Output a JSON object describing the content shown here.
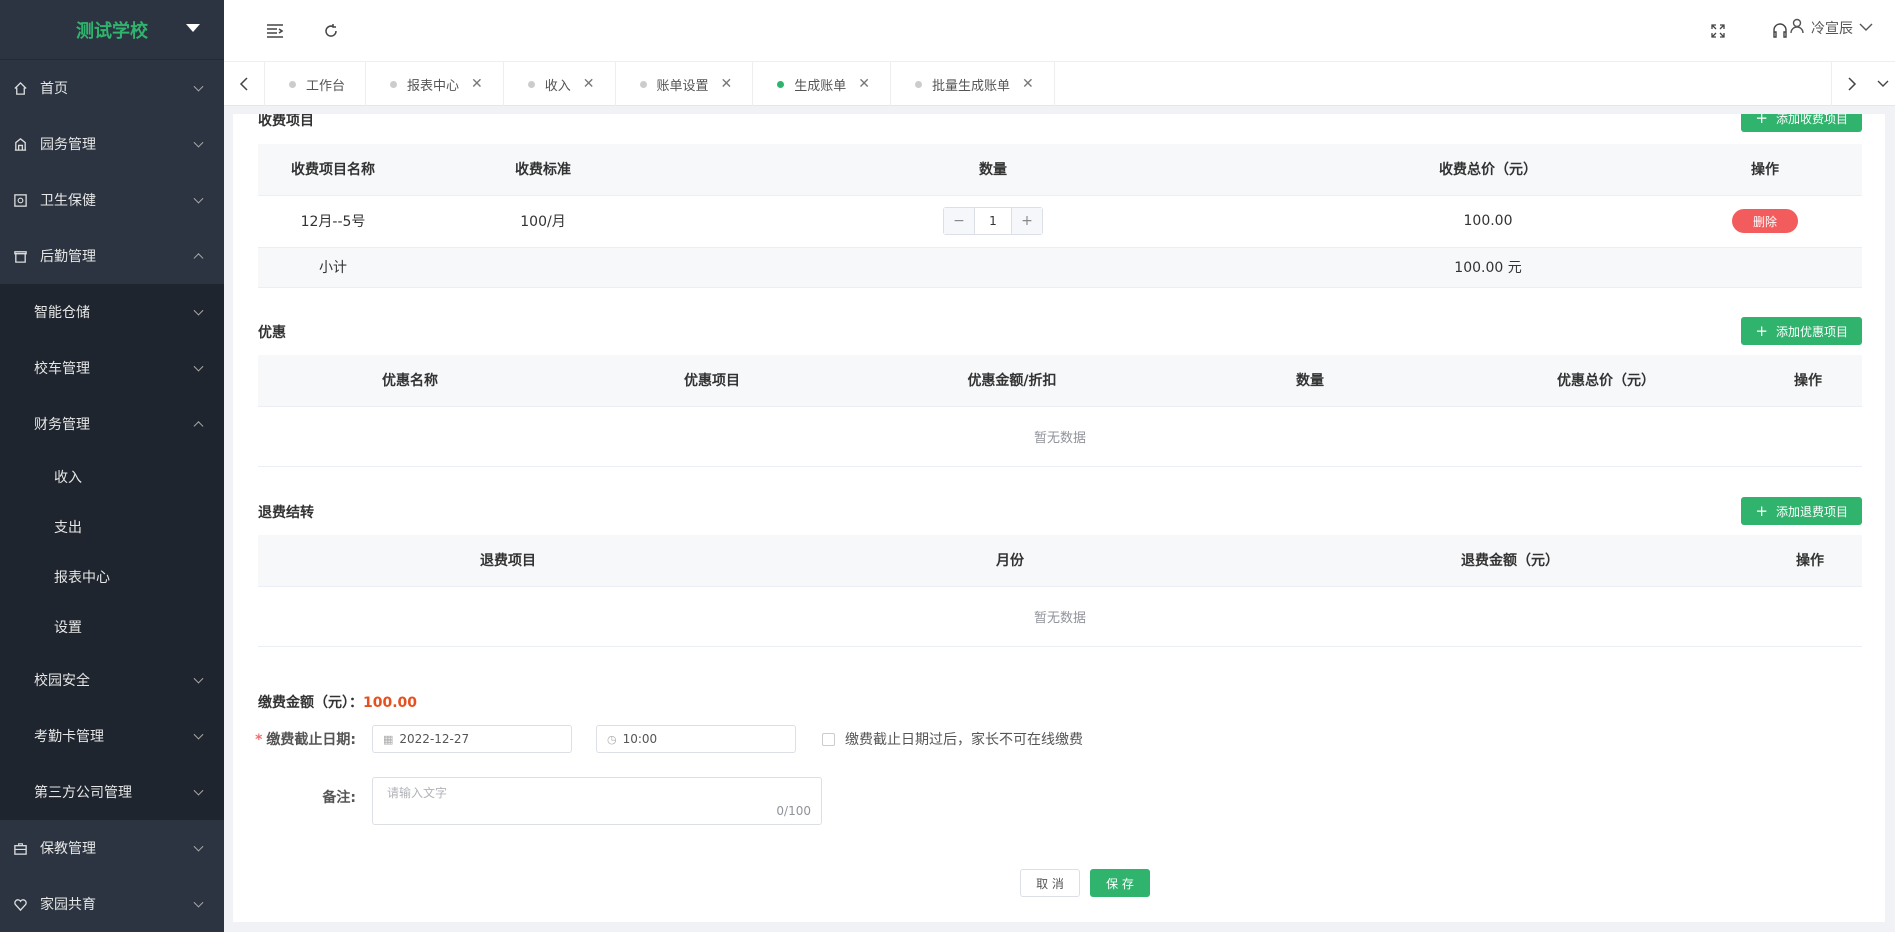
{
  "brand": {
    "name": "测试学校"
  },
  "sidebar": {
    "items": [
      {
        "label": "首页",
        "icon": "home-icon"
      },
      {
        "label": "园务管理",
        "icon": "building-icon"
      },
      {
        "label": "卫生保健",
        "icon": "health-icon"
      },
      {
        "label": "后勤管理",
        "icon": "logistics-icon"
      }
    ],
    "logistics_sub": [
      {
        "label": "智能仓储"
      },
      {
        "label": "校车管理"
      },
      {
        "label": "财务管理"
      }
    ],
    "finance_sub": [
      {
        "label": "收入"
      },
      {
        "label": "支出"
      },
      {
        "label": "报表中心"
      },
      {
        "label": "设置"
      }
    ],
    "logistics_sub_after": [
      {
        "label": "校园安全"
      },
      {
        "label": "考勤卡管理"
      },
      {
        "label": "第三方公司管理"
      }
    ],
    "items_after": [
      {
        "label": "保教管理",
        "icon": "briefcase-icon"
      },
      {
        "label": "家园共育",
        "icon": "heart-icon"
      }
    ]
  },
  "header": {
    "user_name": "冷宣辰"
  },
  "tabs": [
    {
      "label": "工作台"
    },
    {
      "label": "报表中心"
    },
    {
      "label": "收入"
    },
    {
      "label": "账单设置"
    },
    {
      "label": "生成账单"
    },
    {
      "label": "批量生成账单"
    }
  ],
  "fees": {
    "title": "收费项目",
    "add_label": "添加收费项目",
    "columns": [
      "收费项目名称",
      "收费标准",
      "数量",
      "收费总价（元）",
      "操作"
    ],
    "rows": [
      {
        "name": "12月--5号",
        "standard": "100/月",
        "qty": "1",
        "total": "100.00",
        "action": "删除"
      }
    ],
    "subtotal_label": "小计",
    "subtotal_value": "100.00 元"
  },
  "discount": {
    "title": "优惠",
    "add_label": "添加优惠项目",
    "columns": [
      "优惠名称",
      "优惠项目",
      "优惠金额/折扣",
      "数量",
      "优惠总价（元）",
      "操作"
    ],
    "empty": "暂无数据"
  },
  "refund": {
    "title": "退费结转",
    "add_label": "添加退费项目",
    "columns": [
      "退费项目",
      "月份",
      "退费金额（元）",
      "操作"
    ],
    "empty": "暂无数据"
  },
  "payment": {
    "label": "缴费金额（元）：",
    "amount": "100.00",
    "deadline_label": "缴费截止日期:",
    "date": "2022-12-27",
    "time": "10:00",
    "checkbox_label": "缴费截止日期过后，家长不可在线缴费",
    "remark_label": "备注:",
    "remark_placeholder": "请输入文字",
    "remark_count": "0/100"
  },
  "actions": {
    "cancel": "取 消",
    "save": "保 存"
  },
  "colors": {
    "accent": "#2fb36d",
    "danger": "#f25c5c",
    "amount": "#e6501e",
    "sidebar": "#2b3440"
  }
}
